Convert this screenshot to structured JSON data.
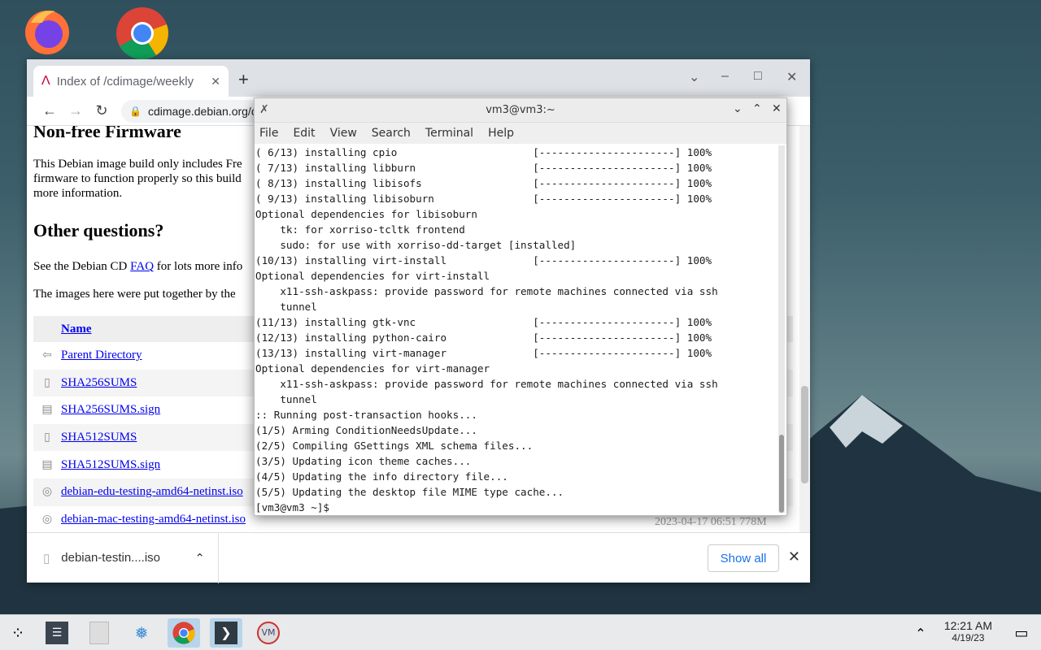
{
  "chrome": {
    "tab_title": "Index of /cdimage/weekly",
    "url": "cdimage.debian.org/c",
    "heading_firmware": "Non-free Firmware",
    "firmware_text_l1": "This Debian image build only includes Fre",
    "firmware_text_l2": "firmware to function properly so this build",
    "firmware_text_l3": "more information.",
    "heading_questions": "Other questions?",
    "faq_prefix": "See the Debian CD ",
    "faq_link": "FAQ",
    "faq_suffix": " for lots more info",
    "images_text": "The images here were put together by the",
    "column_name": "Name",
    "files": [
      {
        "name": "Parent Directory",
        "icon": "back-icon"
      },
      {
        "name": "SHA256SUMS",
        "icon": "text-file-icon"
      },
      {
        "name": "SHA256SUMS.sign",
        "icon": "signature-file-icon"
      },
      {
        "name": "SHA512SUMS",
        "icon": "text-file-icon"
      },
      {
        "name": "SHA512SUMS.sign",
        "icon": "signature-file-icon"
      },
      {
        "name": "debian-edu-testing-amd64-netinst.iso",
        "icon": "disc-icon"
      },
      {
        "name": "debian-mac-testing-amd64-netinst.iso",
        "icon": "disc-icon"
      }
    ],
    "last_row_date": "2023-04-17 06:51 778M",
    "download_file": "debian-testin....iso",
    "show_all": "Show all"
  },
  "terminal": {
    "title": "vm3@vm3:~",
    "menu": [
      "File",
      "Edit",
      "View",
      "Search",
      "Terminal",
      "Help"
    ],
    "lines": [
      "( 6/13) installing cpio                      [----------------------] 100%",
      "( 7/13) installing libburn                   [----------------------] 100%",
      "( 8/13) installing libisofs                  [----------------------] 100%",
      "( 9/13) installing libisoburn                [----------------------] 100%",
      "Optional dependencies for libisoburn",
      "    tk: for xorriso-tcltk frontend",
      "    sudo: for use with xorriso-dd-target [installed]",
      "(10/13) installing virt-install              [----------------------] 100%",
      "Optional dependencies for virt-install",
      "    x11-ssh-askpass: provide password for remote machines connected via ssh",
      "    tunnel",
      "(11/13) installing gtk-vnc                   [----------------------] 100%",
      "(12/13) installing python-cairo              [----------------------] 100%",
      "(13/13) installing virt-manager              [----------------------] 100%",
      "Optional dependencies for virt-manager",
      "    x11-ssh-askpass: provide password for remote machines connected via ssh",
      "    tunnel",
      ":: Running post-transaction hooks...",
      "(1/5) Arming ConditionNeedsUpdate...",
      "(2/5) Compiling GSettings XML schema files...",
      "(3/5) Updating icon theme caches...",
      "(4/5) Updating the info directory file...",
      "(5/5) Updating the desktop file MIME type cache...",
      "[vm3@vm3 ~]$ "
    ]
  },
  "taskbar": {
    "time": "12:21 AM",
    "date": "4/19/23"
  }
}
